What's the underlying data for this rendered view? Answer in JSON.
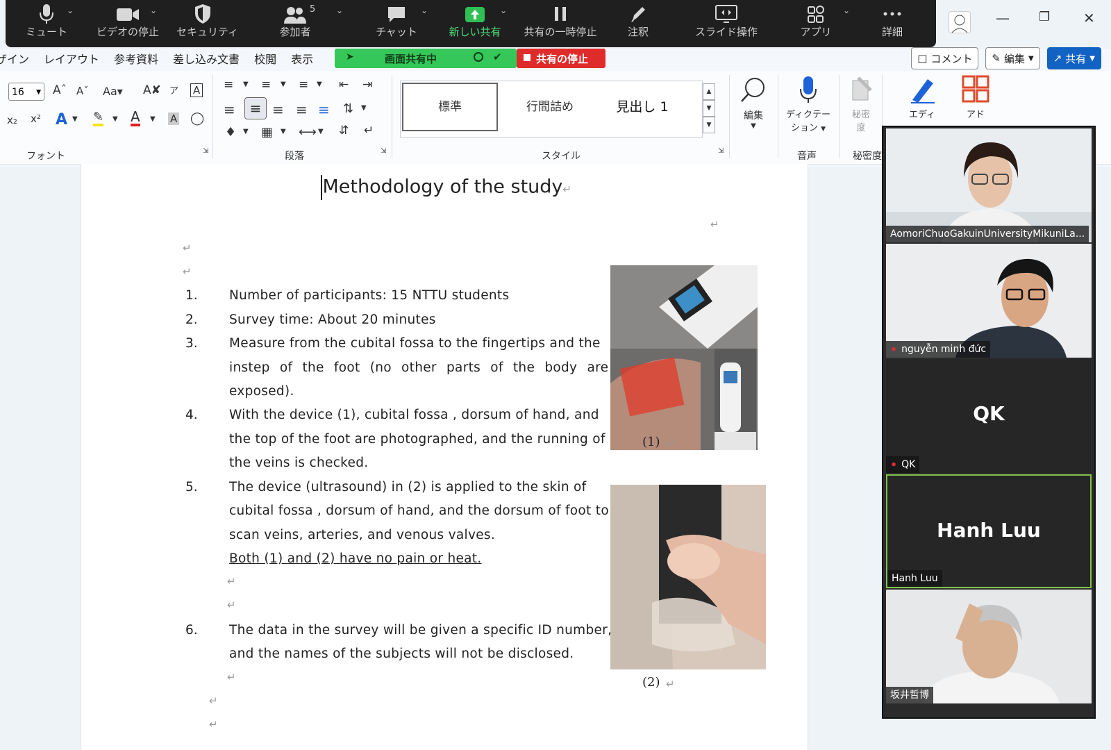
{
  "zoom": {
    "toolbar": [
      {
        "label": "ミュート",
        "icon": "mic-icon"
      },
      {
        "label": "ビデオの停止",
        "icon": "video-icon"
      },
      {
        "label": "セキュリティ",
        "icon": "shield-icon"
      },
      {
        "label": "参加者",
        "icon": "participants-icon",
        "count": "5"
      },
      {
        "label": "チャット",
        "icon": "chat-icon"
      },
      {
        "label": "新しい共有",
        "icon": "share-icon"
      },
      {
        "label": "共有の一時停止",
        "icon": "pause-icon"
      },
      {
        "label": "注釈",
        "icon": "pen-icon"
      },
      {
        "label": "スライド操作",
        "icon": "slide-control-icon"
      },
      {
        "label": "アプリ",
        "icon": "apps-icon"
      },
      {
        "label": "詳細",
        "icon": "more-icon"
      }
    ],
    "sharing_status": "画面共有中",
    "stop_share": "共有の停止",
    "participants": [
      {
        "name": "AomoriChuoGakuinUniversityMikuniLa...",
        "muted": false
      },
      {
        "name": "nguyễn minh đức",
        "muted": true
      },
      {
        "name": "QK",
        "initials": "QK",
        "muted": true
      },
      {
        "name": "Hanh Luu",
        "initials": "Hanh Luu",
        "muted": false,
        "active": true
      },
      {
        "name": "坂井哲博",
        "muted": false
      }
    ]
  },
  "word": {
    "tabs": [
      "ザイン",
      "レイアウト",
      "参考資料",
      "差し込み文書",
      "校閲",
      "表示"
    ],
    "comment_btn": "コメント",
    "edit_btn": "編集",
    "share_btn": "共有",
    "font_size": "16",
    "groups": {
      "font": "フォント",
      "paragraph": "段落",
      "styles": "スタイル",
      "voice": "音声",
      "sensitivity": "秘密度"
    },
    "styles": [
      "標準",
      "行間詰め",
      "見出し 1"
    ],
    "buttons": {
      "edit": "編集",
      "dictate_1": "ディクテー",
      "dictate_2": "ション",
      "sensitivity_1": "秘密",
      "sensitivity_2": "度",
      "editor": "エディ",
      "addins": "アド"
    },
    "doc": {
      "title": "Methodology of the study",
      "items": [
        {
          "num": "1.",
          "lines": [
            "Number of participants: 15 NTTU students"
          ]
        },
        {
          "num": "2.",
          "lines": [
            "Survey time: About 20 minutes"
          ]
        },
        {
          "num": "3.",
          "lines": [
            "Measure from the cubital fossa to the fingertips and the",
            "instep of the foot (no other parts of the body are",
            "exposed)."
          ]
        },
        {
          "num": "4.",
          "lines": [
            "With the device (1), cubital fossa , dorsum of hand, and",
            "the top of the foot are photographed, and the running of",
            "the veins is checked."
          ]
        },
        {
          "num": "5.",
          "lines": [
            "The device (ultrasound) in (2) is applied to the skin of",
            "cubital fossa , dorsum of hand, and the dorsum of foot to",
            "scan veins, arteries, and venous valves."
          ]
        },
        {
          "num": "6.",
          "lines": [
            "The data in the survey will be given a specific ID number,",
            "and the names of the subjects will not be disclosed."
          ]
        }
      ],
      "note": "Both (1) and (2) have no pain or heat.",
      "caption1": "(1)",
      "caption2": "(2)"
    }
  }
}
